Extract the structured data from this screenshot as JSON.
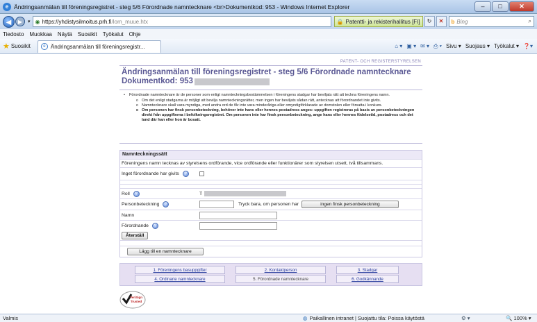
{
  "window": {
    "title": "Ändringsanmälan till föreningsregistret - steg 5/6 Förordnade namntecknare <br>Dokumentkod: 953 - Windows Internet Explorer",
    "min": "–",
    "max": "□",
    "close": "✕"
  },
  "address": {
    "url_host": "https://yhdistysilmoitus.prh.fi",
    "url_rest": "/lom_muue.htx",
    "cert_text": "Patentti- ja rekisterihallitus [FI]",
    "search_engine": "Bing"
  },
  "menu": [
    "Tiedosto",
    "Muokkaa",
    "Näytä",
    "Suosikit",
    "Työkalut",
    "Ohje"
  ],
  "favorites": {
    "label": "Suosikit",
    "tab_title": "Ändringsanmälan till föreningsregistr...",
    "commands": [
      "Sivu ▾",
      "Suojaus ▾",
      "Työkalut ▾"
    ]
  },
  "page": {
    "header_brand": "PATENT- OCH REGISTERSTYRELSEN",
    "title_line1": "Ändringsanmälan till föreningsregistret - steg 5/6 Förordnade namntecknare",
    "title_line2": "Dokumentkod: 953",
    "instructions": {
      "main": "Förordnade namntecknare är de personer som enligt namnteckningsbestämmelsen i föreningens stadgar har beviljats rätt att teckna föreningens namn.",
      "items": [
        "Om det enligt stadgarna är möjligt att bevilja namnteckningsrätter, men ingen har beviljats sådan rätt, antecknas att förordnandet inte givits.",
        "Namntecknare skall vara myndiga, med andra ord de får inte vara minderåriga eller omyndigförklarade av domstolen eller försatta i konkurs.",
        "Om personen har finsk personbeteckning, behöver inte hans eller hennes postadress anges: uppgiften registreras på basis av personbeteckningen direkt från uppgifterna i befolkningsregistret. Om personen inte har finsk personbeteckning, ange hans eller hennes födelsetid, postadress och det land där han eller hon är bosatt."
      ]
    },
    "form": {
      "section_title": "Namntecknings­sätt",
      "signing_method": "Föreningens namn tecknas av styrelsens ordförande, vice ordförande eller funktionärer som styrelsen utsett, två tillsammans.",
      "not_given_label": "Inget förordnande har givits",
      "role_label": "Roll",
      "role_value": "T",
      "pid_label": "Personbeteckning",
      "pid_hint": "Tryck bara, om personen har",
      "no_pid_button": "ingen finsk personbeteckning",
      "name_label": "Namn",
      "fornames_label": "Förordnande",
      "reset_button": "Återställ",
      "add_button": "Lägg till en namntecknare"
    },
    "steps": [
      {
        "label": "1. Föreningens basuppgifter",
        "current": false
      },
      {
        "label": "2. Kontaktperson",
        "current": false
      },
      {
        "label": "3. Stadgar",
        "current": false
      },
      {
        "label": "4. Ordinarie namntecknare",
        "current": false
      },
      {
        "label": "5. Förordnade namntecknare",
        "current": true
      },
      {
        "label": "6. Godkännande",
        "current": false
      }
    ],
    "verisign": {
      "line1": "VeriSign",
      "line2": "Trusted"
    }
  },
  "status": {
    "left": "Valmis",
    "zone": "Paikallinen intranet | Suojattu tila: Poissa käytöstä",
    "zoom": "100%"
  }
}
